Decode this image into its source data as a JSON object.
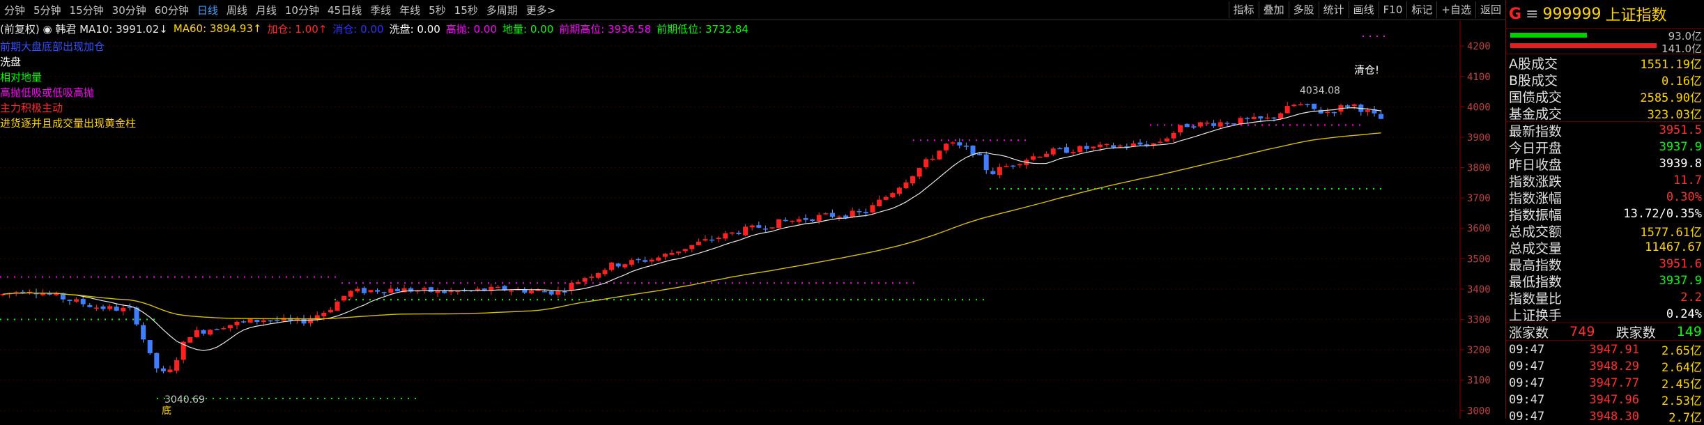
{
  "toolbar": {
    "periods": [
      "5分钟",
      "15分钟",
      "30分钟",
      "60分钟",
      "日线",
      "周线",
      "月线",
      "10分钟",
      "45日线",
      "季线",
      "年线",
      "5秒",
      "15秒",
      "多周期",
      "更多>"
    ],
    "active_period": "日线",
    "right_tools": [
      "指标",
      "叠加",
      "多股",
      "统计",
      "画线",
      "F10",
      "标记",
      "+自选",
      "返回"
    ],
    "partial_first": "分钟"
  },
  "legend": [
    {
      "text": "(前复权) ◉ 韩君 MA10: 3991.02↓",
      "color": "#e6e6e6"
    },
    {
      "text": "MA60: 3894.93↑",
      "color": "#ffd400"
    },
    {
      "text": "加仓: 1.00↑",
      "color": "#ff2a2a"
    },
    {
      "text": "消仓: 0.00",
      "color": "#3030ff"
    },
    {
      "text": "洗盘: 0.00",
      "color": "#ffffff"
    },
    {
      "text": "高抛: 0.00",
      "color": "#ff00ff"
    },
    {
      "text": "地量: 0.00",
      "color": "#00ff00"
    },
    {
      "text": "前期高位: 3936.58",
      "color": "#ff00ff"
    },
    {
      "text": "前期低位: 3732.84",
      "color": "#00ff00"
    }
  ],
  "signals": [
    {
      "text": "前期大盘底部出现加仓",
      "color": "#3050ff"
    },
    {
      "text": "洗盘",
      "color": "#ffffff"
    },
    {
      "text": "相对地量",
      "color": "#00ff00"
    },
    {
      "text": "高抛低吸或低吸高抛",
      "color": "#ff00ff"
    },
    {
      "text": "主力积极主动",
      "color": "#ff2a2a"
    },
    {
      "text": "进货逐并且成交量出现黄金柱",
      "color": "#ffd400"
    }
  ],
  "chart_data": {
    "type": "candlestick",
    "ylim": [
      2980,
      4260
    ],
    "y_ticks": [
      4200,
      4100,
      4000,
      3900,
      3800,
      3700,
      3600,
      3500,
      3400,
      3300,
      3200,
      3100,
      3000
    ],
    "annotations": {
      "high_label": "4034.08",
      "low_label": "3040.69",
      "low_marker": "底",
      "sell_signal": "清仓!"
    },
    "prev_high_lines": [
      3440,
      3420,
      3890,
      3940
    ],
    "prev_low_lines": [
      3300,
      3040,
      3365,
      3730
    ]
  },
  "panel": {
    "code_prefix": "G",
    "code": "999999",
    "name": "上证指数",
    "bar_up_value": "93.0亿",
    "bar_dn_value": "141.0亿",
    "rows": [
      {
        "k": "A股成交",
        "v": "1551.19亿",
        "c": "#ffd400"
      },
      {
        "k": "B股成交",
        "v": "0.16亿",
        "c": "#ffd400"
      },
      {
        "k": "国债成交",
        "v": "2585.90亿",
        "c": "#ffd400"
      },
      {
        "k": "基金成交",
        "v": "323.03亿",
        "c": "#ffd400"
      },
      {
        "k": "最新指数",
        "v": "3951.5",
        "c": "#ff3030"
      },
      {
        "k": "今日开盘",
        "v": "3937.9",
        "c": "#00ff00"
      },
      {
        "k": "昨日收盘",
        "v": "3939.8",
        "c": "#ffffff"
      },
      {
        "k": "指数涨跌",
        "v": "11.7",
        "c": "#ff3030"
      },
      {
        "k": "指数涨幅",
        "v": "0.30%",
        "c": "#ff3030"
      },
      {
        "k": "指数振幅",
        "v": "13.72/0.35%",
        "c": "#ffffff"
      },
      {
        "k": "总成交额",
        "v": "1577.61亿",
        "c": "#ffd400"
      },
      {
        "k": "总成交量",
        "v": "11467.67",
        "c": "#ffd400"
      },
      {
        "k": "最高指数",
        "v": "3951.6",
        "c": "#ff3030"
      },
      {
        "k": "最低指数",
        "v": "3937.9",
        "c": "#00ff00"
      },
      {
        "k": "指数量比",
        "v": "2.2",
        "c": "#ff3030"
      },
      {
        "k": "上证换手",
        "v": "0.24%",
        "c": "#ffffff"
      }
    ],
    "updown": {
      "up_label": "涨家数",
      "up": "749",
      "down_label": "跌家数",
      "down": "149"
    },
    "ticks": [
      {
        "t": "09:47",
        "p": "3947.91",
        "v": "2.65亿"
      },
      {
        "t": "09:47",
        "p": "3948.29",
        "v": "2.64亿"
      },
      {
        "t": "09:47",
        "p": "3947.77",
        "v": "2.45亿"
      },
      {
        "t": "09:47",
        "p": "3947.96",
        "v": "2.53亿"
      },
      {
        "t": "09:47",
        "p": "3948.30",
        "v": "2.7亿"
      }
    ]
  }
}
